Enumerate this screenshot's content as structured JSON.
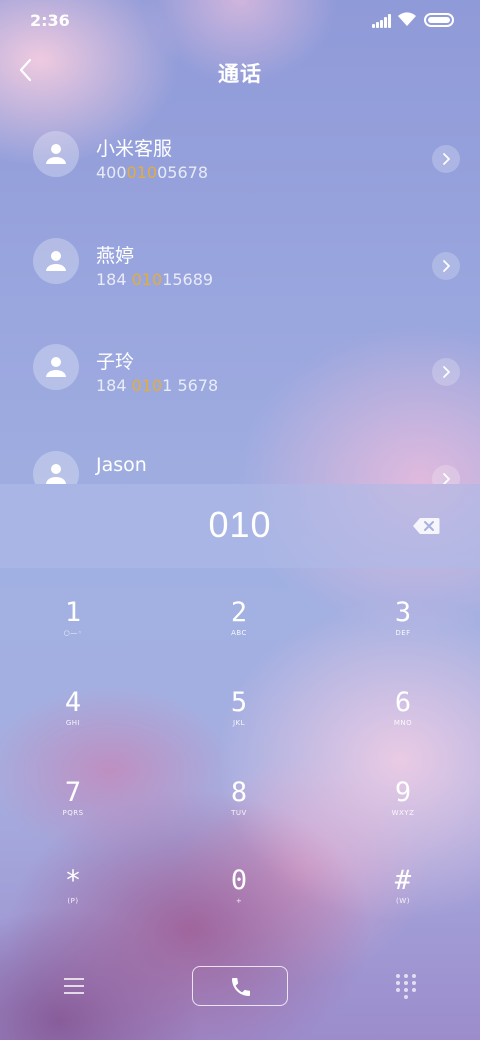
{
  "status": {
    "time": "2:36",
    "signal_icon": "signal-icon",
    "wifi_icon": "wifi-icon",
    "battery_icon": "battery-icon"
  },
  "header": {
    "back_icon": "chevron-left-icon",
    "title": "通话"
  },
  "contacts": [
    {
      "name": "小米客服",
      "number_pre": "400",
      "number_match": "010",
      "number_post": "05678"
    },
    {
      "name": "燕婷",
      "number_pre": "184 ",
      "number_match": "010",
      "number_post": "15689"
    },
    {
      "name": "子玲",
      "number_pre": "184 ",
      "number_match": "010",
      "number_post": "1 5678"
    },
    {
      "name": "Jason",
      "number_pre": "",
      "number_match": "",
      "number_post": ""
    }
  ],
  "dial": {
    "number": "010",
    "backspace_icon": "backspace-icon"
  },
  "keypad": [
    {
      "digit": "1",
      "letters": "○—◦"
    },
    {
      "digit": "2",
      "letters": "ABC"
    },
    {
      "digit": "3",
      "letters": "DEF"
    },
    {
      "digit": "4",
      "letters": "GHI"
    },
    {
      "digit": "5",
      "letters": "JKL"
    },
    {
      "digit": "6",
      "letters": "MNO"
    },
    {
      "digit": "7",
      "letters": "PQRS"
    },
    {
      "digit": "8",
      "letters": "TUV"
    },
    {
      "digit": "9",
      "letters": "WXYZ"
    },
    {
      "digit": "*",
      "letters": "(P)"
    },
    {
      "digit": "0",
      "letters": "+"
    },
    {
      "digit": "#",
      "letters": "(W)"
    }
  ],
  "bottom": {
    "menu_icon": "menu-icon",
    "call_icon": "phone-icon",
    "dialpad_icon": "dialpad-icon"
  },
  "colors": {
    "match_highlight": "#e3ad3c"
  }
}
